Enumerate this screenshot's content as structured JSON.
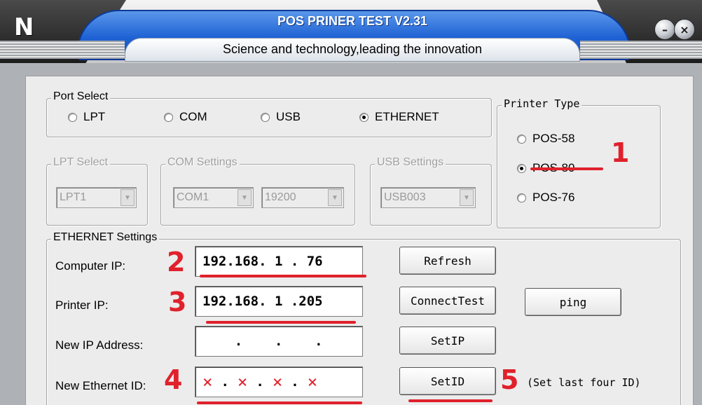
{
  "window": {
    "title": "POS PRINER TEST V2.31",
    "subtitle": "Science and technology,leading the innovation"
  },
  "port_select": {
    "legend": "Port Select",
    "options": [
      {
        "label": "LPT",
        "selected": false
      },
      {
        "label": "COM",
        "selected": false
      },
      {
        "label": "USB",
        "selected": false
      },
      {
        "label": "ETHERNET",
        "selected": true
      }
    ]
  },
  "printer_type": {
    "legend": "Printer Type",
    "options": [
      {
        "label": "POS-58",
        "selected": false
      },
      {
        "label": "POS-80",
        "selected": true
      },
      {
        "label": "POS-76",
        "selected": false
      }
    ]
  },
  "lpt_select": {
    "legend": "LPT Select",
    "value": "LPT1"
  },
  "com_settings": {
    "legend": "COM Settings",
    "port": "COM1",
    "baud": "19200"
  },
  "usb_settings": {
    "legend": "USB Settings",
    "value": "USB003"
  },
  "ethernet": {
    "legend": "ETHERNET Settings",
    "computer_ip_label": "Computer IP:",
    "computer_ip": "192.168. 1 . 76",
    "printer_ip_label": "Printer IP:",
    "printer_ip": "192.168. 1 .205",
    "new_ip_label": "New IP Address:",
    "new_ip": "    .    .    .",
    "new_id_label": "New Ethernet ID:",
    "new_id_parts": [
      "×",
      ".",
      "×",
      ".",
      "×",
      ".",
      "×"
    ]
  },
  "buttons": {
    "refresh": "Refresh",
    "connect_test": "ConnectTest",
    "ping": "ping",
    "set_ip": "SetIP",
    "set_id": "SetID"
  },
  "annotations": {
    "n1": "1",
    "n2": "2",
    "n3": "3",
    "n4": "4",
    "n5": "5",
    "note": "(Set last four ID)",
    "color": "#e0212b"
  },
  "colors": {
    "title_blue": "#1f62d4",
    "dialog_bg": "#ececec",
    "frame_gray": "#aeb1b5"
  },
  "icons": {
    "app": "app-logo-icon",
    "minimize": "minimize-icon",
    "close": "close-icon"
  }
}
